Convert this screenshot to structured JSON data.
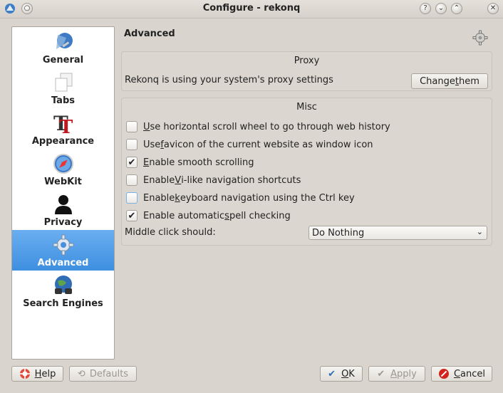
{
  "window": {
    "title": "Configure - rekonq",
    "controls": [
      "help-icon",
      "minimize-icon",
      "maximize-icon",
      "close-icon"
    ]
  },
  "sidebar": {
    "items": [
      {
        "label": "General",
        "icon": "general-icon"
      },
      {
        "label": "Tabs",
        "icon": "tabs-icon"
      },
      {
        "label": "Appearance",
        "icon": "appearance-icon"
      },
      {
        "label": "WebKit",
        "icon": "webkit-icon"
      },
      {
        "label": "Privacy",
        "icon": "privacy-icon"
      },
      {
        "label": "Advanced",
        "icon": "gear-icon",
        "selected": true
      },
      {
        "label": "Search Engines",
        "icon": "search-engines-icon"
      }
    ]
  },
  "page": {
    "title": "Advanced",
    "proxy": {
      "group_title": "Proxy",
      "text": "Rekonq is using your system's proxy settings",
      "button_pre": "Change ",
      "button_mn": "t",
      "button_post": "hem"
    },
    "misc": {
      "group_title": "Misc",
      "options": [
        {
          "pre": "",
          "mn": "U",
          "post": "se horizontal scroll wheel to go through web history",
          "checked": false
        },
        {
          "pre": "Use ",
          "mn": "f",
          "post": "avicon of the current website as window icon",
          "checked": false
        },
        {
          "pre": "",
          "mn": "E",
          "post": "nable smooth scrolling",
          "checked": true
        },
        {
          "pre": "Enable ",
          "mn": "V",
          "post": "i-like navigation shortcuts",
          "checked": false
        },
        {
          "pre": "Enable ",
          "mn": "k",
          "post": "eyboard navigation using the Ctrl key",
          "checked": false
        },
        {
          "pre": "Enable automatic ",
          "mn": "s",
          "post": "pell checking",
          "checked": true
        }
      ],
      "middle_click_label": "Middle click should:",
      "middle_click_value": "Do Nothing"
    }
  },
  "buttons": {
    "help_mn": "H",
    "help_post": "elp",
    "defaults": "Defaults",
    "ok_mn": "O",
    "ok_post": "K",
    "apply_mn": "A",
    "apply_post": "pply",
    "cancel_mn": "C",
    "cancel_post": "ancel"
  },
  "colors": {
    "selection": "#4a97e6",
    "background": "#d9d4cd"
  }
}
